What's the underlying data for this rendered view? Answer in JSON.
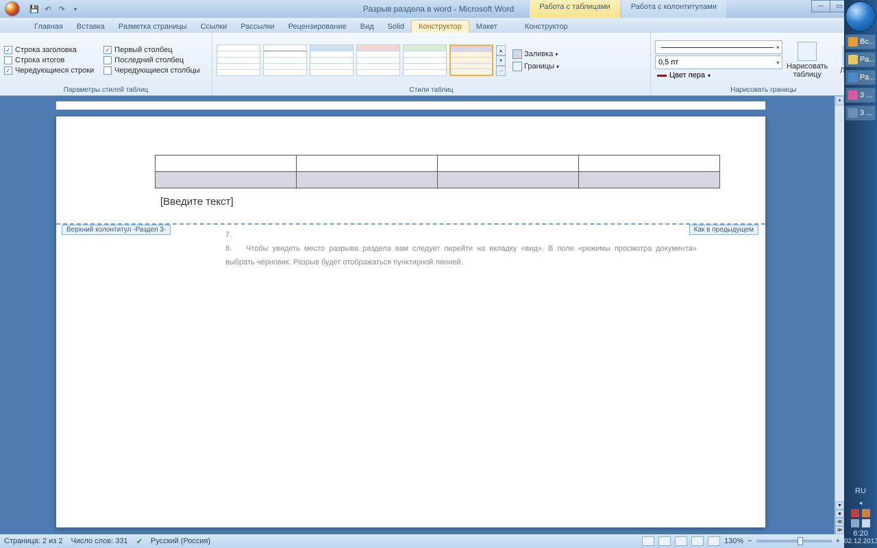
{
  "title": "Разрыв раздела в word - Microsoft Word",
  "context_tabs": {
    "tables": "Работа с таблицами",
    "headers": "Работа с колонтитулами"
  },
  "tabs": [
    "Главная",
    "Вставка",
    "Разметка страницы",
    "Ссылки",
    "Рассылки",
    "Рецензирование",
    "Вид",
    "Solid",
    "Конструктор",
    "Макет",
    "Конструктор"
  ],
  "active_tab_index": 8,
  "group_labels": {
    "tableopts": "Параметры стилей таблиц",
    "styles": "Стили таблиц",
    "draw": "Нарисовать границы"
  },
  "checks": {
    "header_row": "Строка заголовка",
    "total_row": "Строка итогов",
    "banded_rows": "Чередующиеся строки",
    "first_col": "Первый столбец",
    "last_col": "Последний столбец",
    "banded_cols": "Чередующиеся столбцы"
  },
  "shading": {
    "fill": "Заливка",
    "borders": "Границы"
  },
  "draw": {
    "width": "0,5 пт",
    "pen": "Цвет пера",
    "draw_table": "Нарисовать таблицу",
    "eraser": "Ластик"
  },
  "doc": {
    "placeholder": "[Введите текст]",
    "header_tag_left": "Верхний колонтитул -Раздел 3-",
    "header_tag_right": "Как в предыдущем",
    "list7": "7.",
    "list8": "8.",
    "para": "Чтобы увидеть место разрыва раздела вам следует перейти на вкладку «вид». В поле «режимы просмотра документа» выбрать черновик. Разрыв будет отображаться пунктирной линией."
  },
  "status": {
    "page": "Страница: 2 из 2",
    "words": "Число слов: 331",
    "lang": "Русский (Россия)",
    "zoom": "130%"
  },
  "taskbar": {
    "items": [
      "Вс...",
      "Ра...",
      "Ра...",
      "3 ...",
      "3 ..."
    ],
    "lang": "RU",
    "time": "6:20",
    "date": "02.12.2013"
  }
}
